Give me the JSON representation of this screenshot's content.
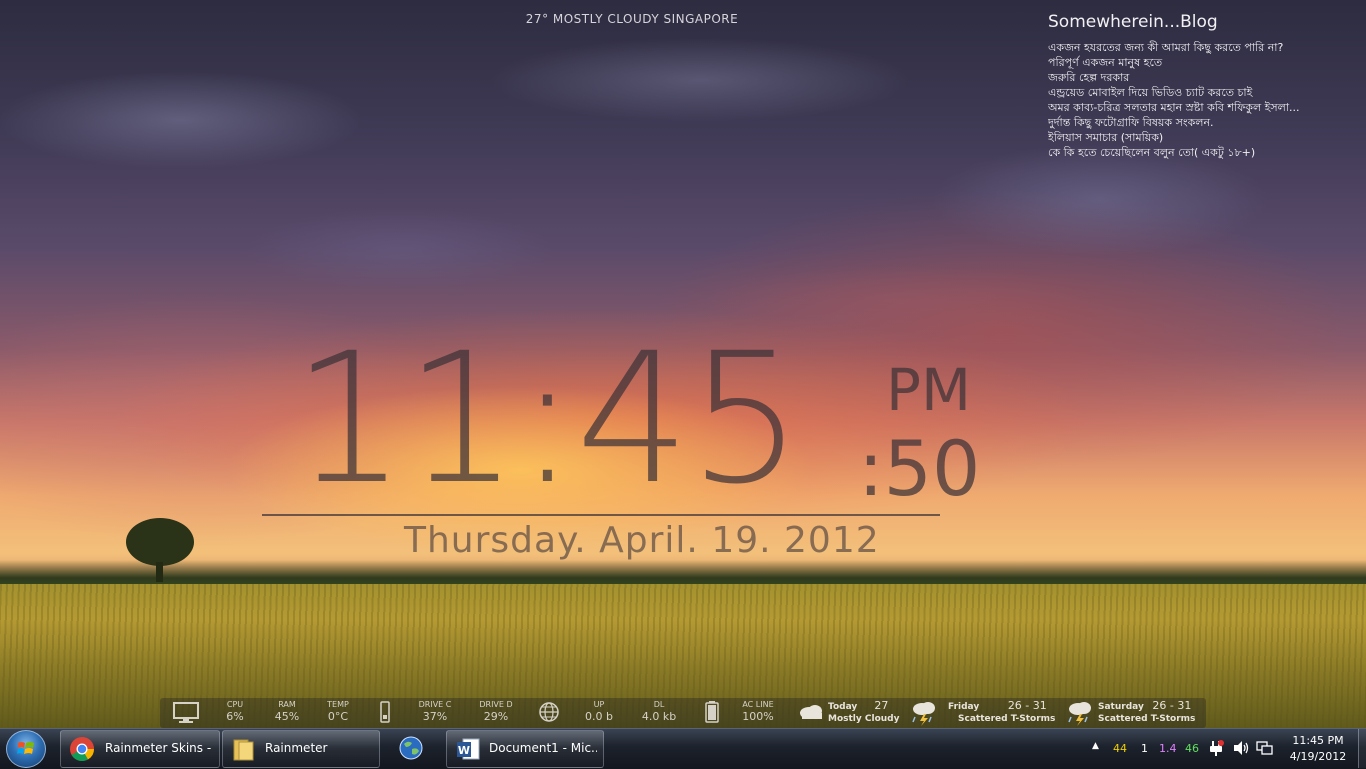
{
  "weather_top": "27° MOSTLY CLOUDY SINGAPORE",
  "blog": {
    "title": "Somewherein...Blog",
    "items": [
      "একজন হযরতের জন্য কী আমরা কিছু করতে পারি না?",
      "পরিপূর্ণ একজন মানুষ হতে",
      "জরুরি হেল্প দরকার",
      "এন্ড্রয়েড মোবাইল দিয়ে ভিডিও চ্যাট করতে চাই",
      "অমর কাব্য-চরিত্র সলতার মহান স্রষ্টা কবি শফিকুল ইসলা...",
      "দুর্দান্ত কিছু ফটোগ্রাফি বিষয়ক সংকলন.",
      "ইলিয়াস সমাচার (সাময়িক)",
      "কে কি হতে চেয়েছিলেন বলুন তো( একটু ১৮+)"
    ]
  },
  "clock": {
    "time": "11:45",
    "ampm": "PM",
    "seconds": ":50",
    "date": "Thursday. April. 19. 2012"
  },
  "sysmon": {
    "cpu": {
      "label": "CPU",
      "value": "6%"
    },
    "ram": {
      "label": "RAM",
      "value": "45%"
    },
    "temp": {
      "label": "TEMP",
      "value": "0°C"
    },
    "drive_c": {
      "label": "DRIVE C",
      "value": "37%"
    },
    "drive_d": {
      "label": "DRIVE D",
      "value": "29%"
    },
    "up": {
      "label": "UP",
      "value": "0.0 b"
    },
    "dl": {
      "label": "DL",
      "value": "4.0 kb"
    },
    "ac": {
      "label": "AC LINE",
      "value": "100%"
    }
  },
  "forecast": [
    {
      "day": "Today",
      "temp": "27",
      "cond": "Mostly Cloudy"
    },
    {
      "day": "Friday",
      "temp": "26 - 31",
      "cond": "Scattered T-Storms"
    },
    {
      "day": "Saturday",
      "temp": "26 - 31",
      "cond": "Scattered T-Storms"
    }
  ],
  "taskbar": {
    "tasks": [
      {
        "label": "Rainmeter Skins - ..."
      },
      {
        "label": "Rainmeter"
      },
      {
        "label": ""
      },
      {
        "label": "Document1 - Mic..."
      }
    ],
    "tray": {
      "numbers": [
        "44",
        "1",
        "1.4",
        "46"
      ],
      "colors": [
        "#f0d000",
        "#ffffff",
        "#e080ff",
        "#60e060"
      ],
      "time": "11:45 PM",
      "date": "4/19/2012"
    }
  }
}
